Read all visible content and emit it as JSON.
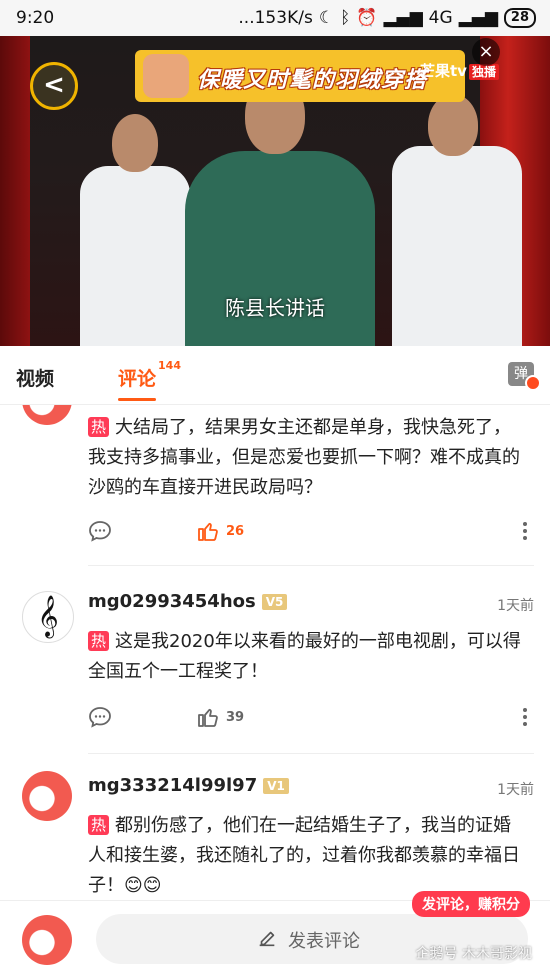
{
  "status_bar": {
    "time": "9:20",
    "network": "...153K/s",
    "signal": "4G",
    "battery": "28"
  },
  "video": {
    "banner_text": "保暖又时髦的羽绒穿搭",
    "brand": "芒果tv",
    "brand_tag": "独播",
    "subtitle": "陈县长讲话",
    "close_glyph": "×",
    "back_glyph": "<"
  },
  "tabs": [
    {
      "label": "视频"
    },
    {
      "label": "评论",
      "count": "144"
    }
  ],
  "danmu_label": "弹",
  "comments": [
    {
      "user": "",
      "level": "",
      "time": "",
      "hot_tag": "热",
      "text": "大结局了，结果男女主还都是单身，我快急死了，我支持多搞事业，但是恋爱也要抓一下啊？难不成真的沙鸥的车直接开进民政局吗？",
      "likes": "26"
    },
    {
      "user": "mg02993454hos",
      "level": "V5",
      "time": "1天前",
      "hot_tag": "热",
      "text": "这是我2020年以来看的最好的一部电视剧，可以得全国五个一工程奖了！",
      "likes": "39"
    },
    {
      "user": "mg333214l99l97",
      "level": "V1",
      "time": "1天前",
      "hot_tag": "热",
      "text": "都别伤感了，他们在一起结婚生子了，我当的证婚人和接生婆，我还随礼了的，过着你我都羡慕的幸福日子！😊😊",
      "likes": ""
    }
  ],
  "bottom": {
    "placeholder": "发表评论",
    "promo": "发评论，赚积分",
    "watermark": "企鹅号 木木哥影视"
  },
  "colors": {
    "accent": "#ff5a14",
    "hot": "#ff3b56"
  }
}
